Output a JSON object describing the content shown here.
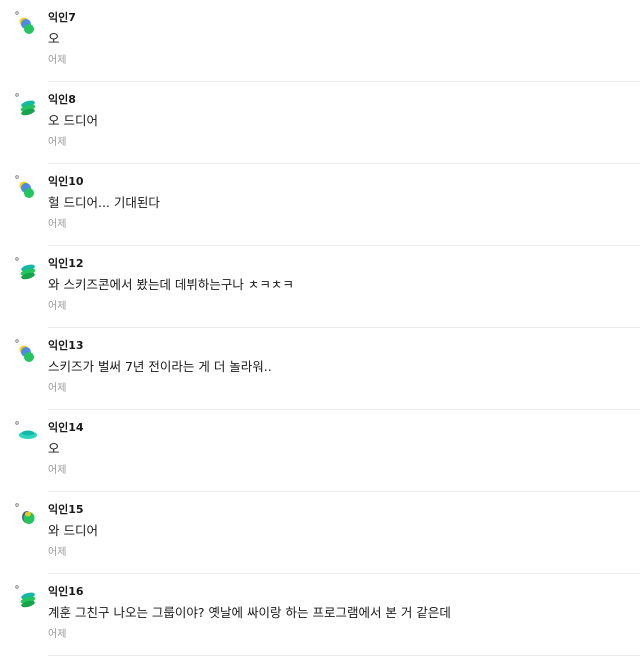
{
  "comments": [
    {
      "nickname": "익인7",
      "text": "오",
      "date": "어제",
      "avatar_icon": "blue-green-bubbles-icon"
    },
    {
      "nickname": "익인8",
      "text": "오 드디어",
      "date": "어제",
      "avatar_icon": "green-stacked-icon"
    },
    {
      "nickname": "익인10",
      "text": "헐 드디어... 기대된다",
      "date": "어제",
      "avatar_icon": "blue-green-bubbles-icon"
    },
    {
      "nickname": "익인12",
      "text": "와 스키즈콘에서 봤는데 데뷔하는구나 ㅊㅋㅊㅋ",
      "date": "어제",
      "avatar_icon": "green-stacked-icon"
    },
    {
      "nickname": "익인13",
      "text": "스키즈가 벌써 7년 전이라는 게 더 놀라워..",
      "date": "어제",
      "avatar_icon": "blue-green-bubbles-icon"
    },
    {
      "nickname": "익인14",
      "text": "오",
      "date": "어제",
      "avatar_icon": "teal-cloud-icon"
    },
    {
      "nickname": "익인15",
      "text": "와 드디어",
      "date": "어제",
      "avatar_icon": "green-leaf-icon"
    },
    {
      "nickname": "익인16",
      "text": "계훈 그친구 나오는 그룹이야? 옛날에 싸이랑 하는 프로그램에서 본 거 같은데",
      "date": "어제",
      "avatar_icon": "green-stacked-icon"
    }
  ],
  "colors": {
    "accent_green": "#22c55e",
    "accent_teal": "#14b8a6",
    "accent_blue": "#3b82f6",
    "accent_yellow": "#facc15",
    "date_gray": "#9a9a9a",
    "divider": "#ececec"
  }
}
